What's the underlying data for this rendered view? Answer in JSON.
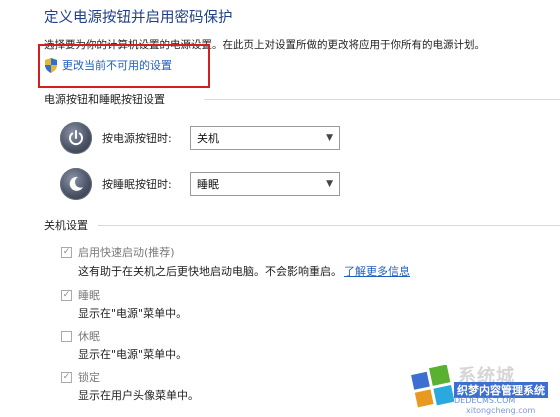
{
  "page": {
    "title": "定义电源按钮并启用密码保护",
    "description": "选择要为你的计算机设置的电源设置。在此页上对设置所做的更改将应用于你所有的电源计划。",
    "change_link": "更改当前不可用的设置",
    "shield_icon": "uac-shield-icon"
  },
  "power_section": {
    "label": "电源按钮和睡眠按钮设置",
    "rows": [
      {
        "label": "按电源按钮时:",
        "value": "关机",
        "icon": "power-button-icon"
      },
      {
        "label": "按睡眠按钮时:",
        "value": "睡眠",
        "icon": "sleep-button-icon"
      }
    ]
  },
  "shutdown_section": {
    "label": "关机设置",
    "options": [
      {
        "label": "启用快速启动(推荐)",
        "checked": true,
        "desc": "这有助于在关机之后更快地启动电脑。不会影响重启。",
        "link": "了解更多信息"
      },
      {
        "label": "睡眠",
        "checked": true,
        "desc": "显示在\"电源\"菜单中。"
      },
      {
        "label": "休眠",
        "checked": false,
        "desc": "显示在\"电源\"菜单中。"
      },
      {
        "label": "锁定",
        "checked": true,
        "desc": "显示在用户头像菜单中。"
      }
    ]
  },
  "watermark": {
    "line1": "系统城",
    "line2": "织梦内容管理系统",
    "line3": "DEDECMS.COM",
    "line4": "xitongcheng.com",
    "colors": {
      "blue": "#3d6fd0",
      "green": "#5ab030",
      "orange": "#e89a20",
      "cyan": "#2aa8e0"
    }
  }
}
